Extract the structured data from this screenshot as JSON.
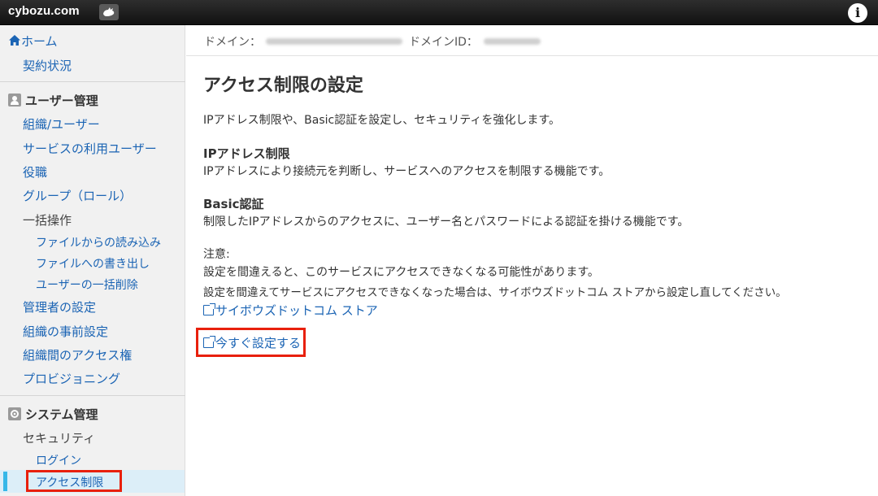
{
  "topbar": {
    "brand": "cybozu.com",
    "info_glyph": "i"
  },
  "sidebar": {
    "home": "ホーム",
    "contract": "契約状況",
    "user_section": "ユーザー管理",
    "user_items": {
      "org_users": "組織/ユーザー",
      "service_users": "サービスの利用ユーザー",
      "positions": "役職",
      "groups": "グループ（ロール）",
      "bulk": "一括操作",
      "bulk_import": "ファイルからの読み込み",
      "bulk_export": "ファイルへの書き出し",
      "bulk_delete": "ユーザーの一括削除",
      "admin_settings": "管理者の設定",
      "org_presets": "組織の事前設定",
      "org_access": "組織間のアクセス権",
      "provisioning": "プロビジョニング"
    },
    "system_section": "システム管理",
    "system_items": {
      "security": "セキュリティ",
      "login": "ログイン",
      "access_restriction": "アクセス制限"
    }
  },
  "domainbar": {
    "domain_label": "ドメイン：",
    "domain_id_label": "ドメインID："
  },
  "main": {
    "title": "アクセス制限の設定",
    "intro": "IPアドレス制限や、Basic認証を設定し、セキュリティを強化します。",
    "ip_heading": "IPアドレス制限",
    "ip_desc": "IPアドレスにより接続元を判断し、サービスへのアクセスを制限する機能です。",
    "basic_heading": "Basic認証",
    "basic_desc": "制限したIPアドレスからのアクセスに、ユーザー名とパスワードによる認証を掛ける機能です。",
    "note_label": "注意:",
    "note_line1": "設定を間違えると、このサービスにアクセスできなくなる可能性があります。",
    "note_line2": "設定を間違えてサービスにアクセスできなくなった場合は、サイボウズドットコム ストアから設定し直してください。",
    "store_link": "サイボウズドットコム ストア",
    "setup_link": "今すぐ設定する"
  }
}
